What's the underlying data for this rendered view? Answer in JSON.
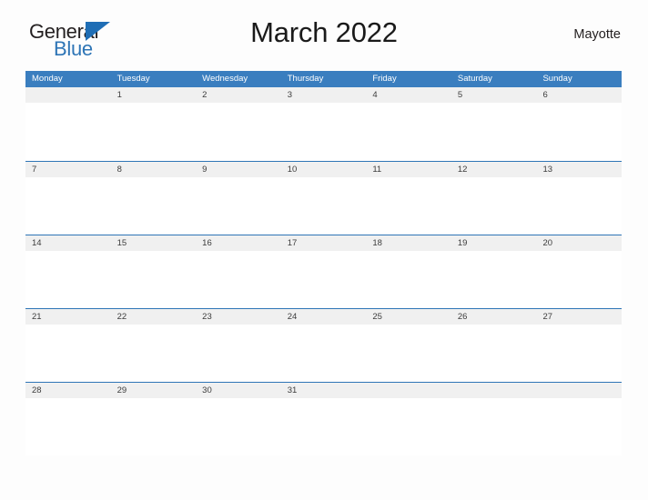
{
  "brand": {
    "name_part1": "General",
    "name_part2": "Blue",
    "triangle_color": "#1f6eb5",
    "text_color": "#231f20",
    "blue_color": "#2e75b6"
  },
  "header": {
    "title": "March 2022",
    "region": "Mayotte"
  },
  "theme": {
    "header_band_color": "#3a7ebf",
    "rule_color": "#2e75b6",
    "date_band_color": "#f0f0f0",
    "page_background": "#fdfdfd",
    "weekday_text_color": "#ffffff",
    "date_text_color": "#3c3c3c"
  },
  "calendar": {
    "month": "March",
    "year": "2022",
    "first_day_of_week": "Monday",
    "weekdays": [
      "Monday",
      "Tuesday",
      "Wednesday",
      "Thursday",
      "Friday",
      "Saturday",
      "Sunday"
    ],
    "weeks": [
      [
        "",
        "1",
        "2",
        "3",
        "4",
        "5",
        "6"
      ],
      [
        "7",
        "8",
        "9",
        "10",
        "11",
        "12",
        "13"
      ],
      [
        "14",
        "15",
        "16",
        "17",
        "18",
        "19",
        "20"
      ],
      [
        "21",
        "22",
        "23",
        "24",
        "25",
        "26",
        "27"
      ],
      [
        "28",
        "29",
        "30",
        "31",
        "",
        "",
        ""
      ]
    ]
  }
}
